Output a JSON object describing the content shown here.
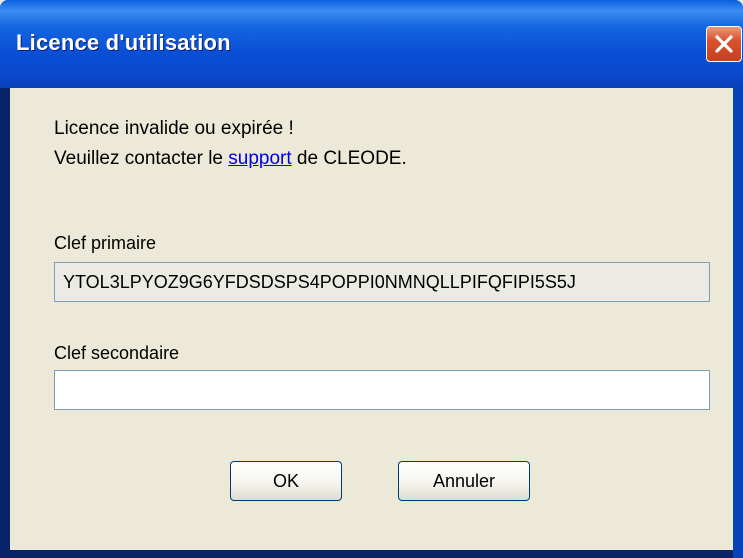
{
  "window": {
    "title": "Licence d'utilisation"
  },
  "message": {
    "line1": "Licence invalide ou expirée !",
    "line2_prefix": "Veuillez contacter le ",
    "link_text": "support",
    "line2_suffix": " de CLEODE."
  },
  "fields": {
    "primary": {
      "label": "Clef primaire",
      "value": "YTOL3LPYOZ9G6YFDSDSPS4POPPI0NMNQLLPIFQFIPI5S5J",
      "readonly": true
    },
    "secondary": {
      "label": "Clef secondaire",
      "value": ""
    }
  },
  "buttons": {
    "ok_label": "OK",
    "cancel_label": "Annuler"
  },
  "icons": {
    "close": "close-icon"
  },
  "colors": {
    "titlebar": "#0a4fd6",
    "dialog_bg": "#ece9d8",
    "link": "#0000ee",
    "close_button": "#d8532d"
  }
}
